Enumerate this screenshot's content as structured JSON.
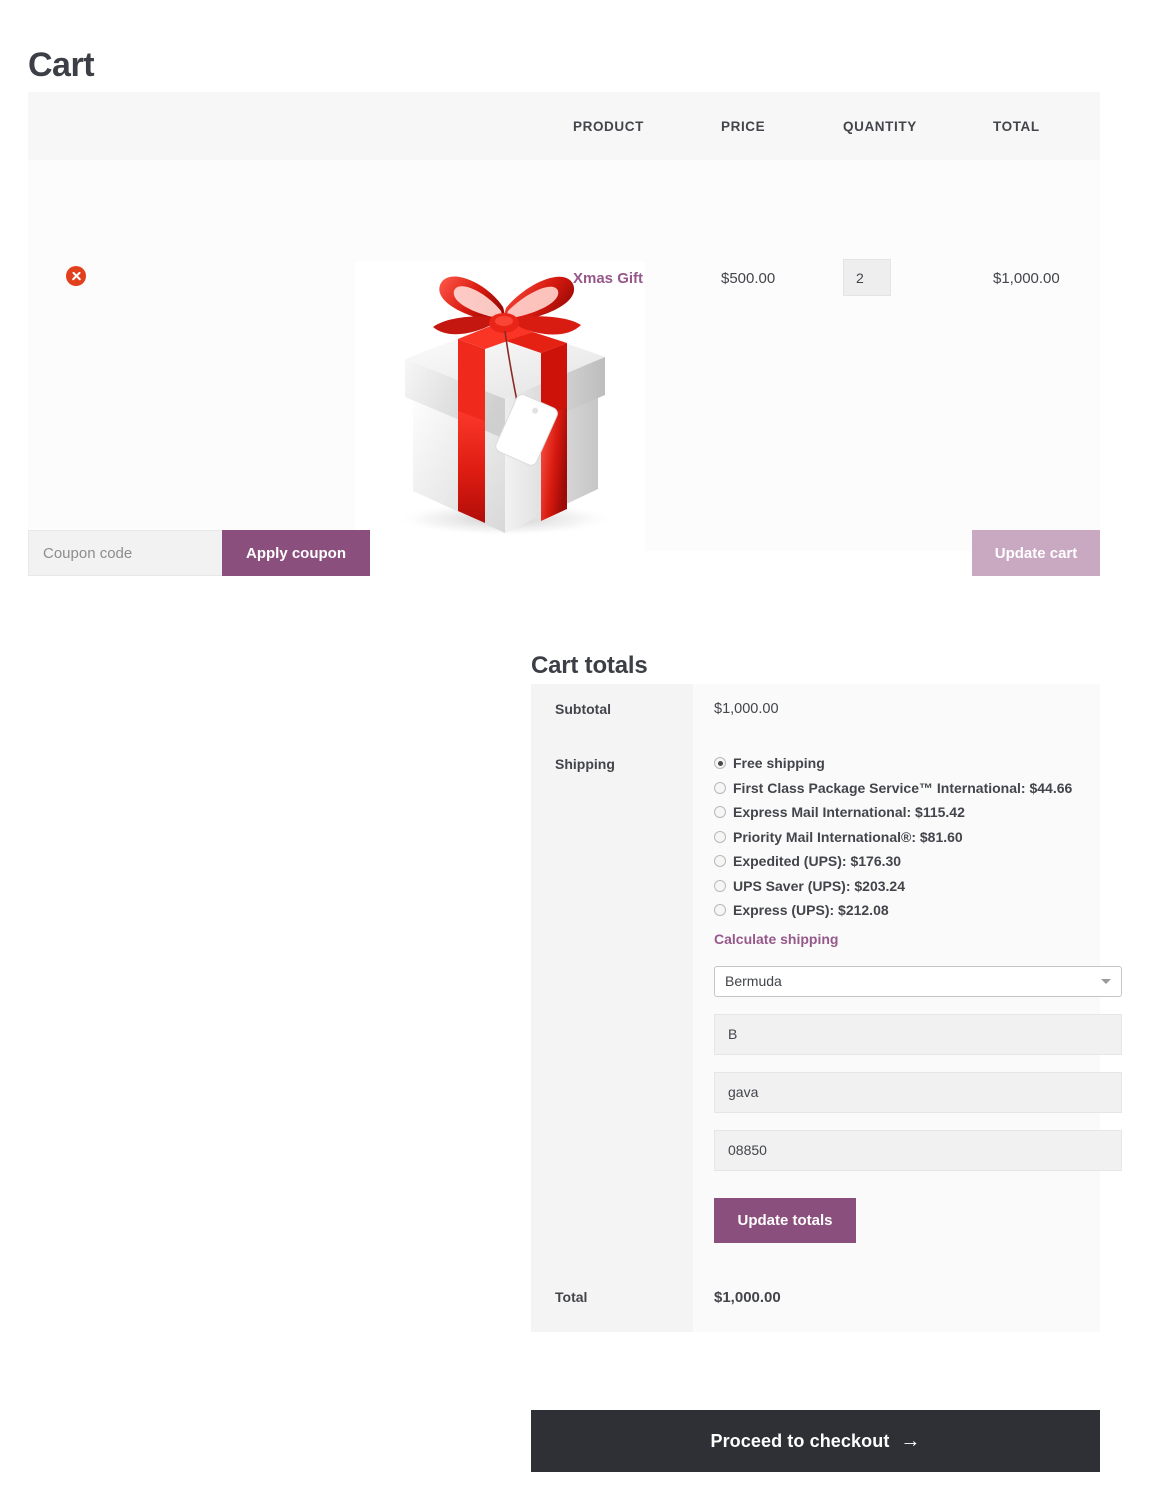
{
  "page": {
    "title": "Cart"
  },
  "cart_table": {
    "headers": {
      "remove": "",
      "thumbnail": "",
      "product": "PRODUCT",
      "price": "PRICE",
      "quantity": "QUANTITY",
      "total": "TOTAL"
    },
    "items": [
      {
        "remove_icon": "remove-item-icon",
        "thumbnail_icon": "gift-box-image",
        "name": "Xmas Gift",
        "price": "$500.00",
        "quantity": "2",
        "total": "$1,000.00"
      }
    ]
  },
  "coupon": {
    "placeholder": "Coupon code",
    "value": "",
    "apply_label": "Apply coupon",
    "update_cart_label": "Update cart"
  },
  "totals": {
    "heading": "Cart totals",
    "subtotal_label": "Subtotal",
    "subtotal_value": "$1,000.00",
    "shipping_label": "Shipping",
    "shipping_options": [
      {
        "label": "Free shipping",
        "selected": true
      },
      {
        "label": "First Class Package Service™ International: $44.66",
        "selected": false
      },
      {
        "label": "Express Mail International: $115.42",
        "selected": false
      },
      {
        "label": "Priority Mail International®: $81.60",
        "selected": false
      },
      {
        "label": "Expedited (UPS): $176.30",
        "selected": false
      },
      {
        "label": "UPS Saver (UPS): $203.24",
        "selected": false
      },
      {
        "label": "Express (UPS): $212.08",
        "selected": false
      }
    ],
    "calculate_shipping_label": "Calculate shipping",
    "calc_form": {
      "country_value": "Bermuda",
      "state_value": "B",
      "city_value": "gava",
      "postcode_value": "08850",
      "update_totals_label": "Update totals"
    },
    "total_label": "Total",
    "total_value": "$1,000.00"
  },
  "checkout": {
    "label": "Proceed to checkout",
    "arrow_icon": "→"
  },
  "colors": {
    "accent_purple": "#8a4f7d",
    "link_purple": "#96588a",
    "disabled_purple": "#c9a8c2",
    "remove_red": "#e2401c",
    "checkout_dark": "#2e3036"
  }
}
